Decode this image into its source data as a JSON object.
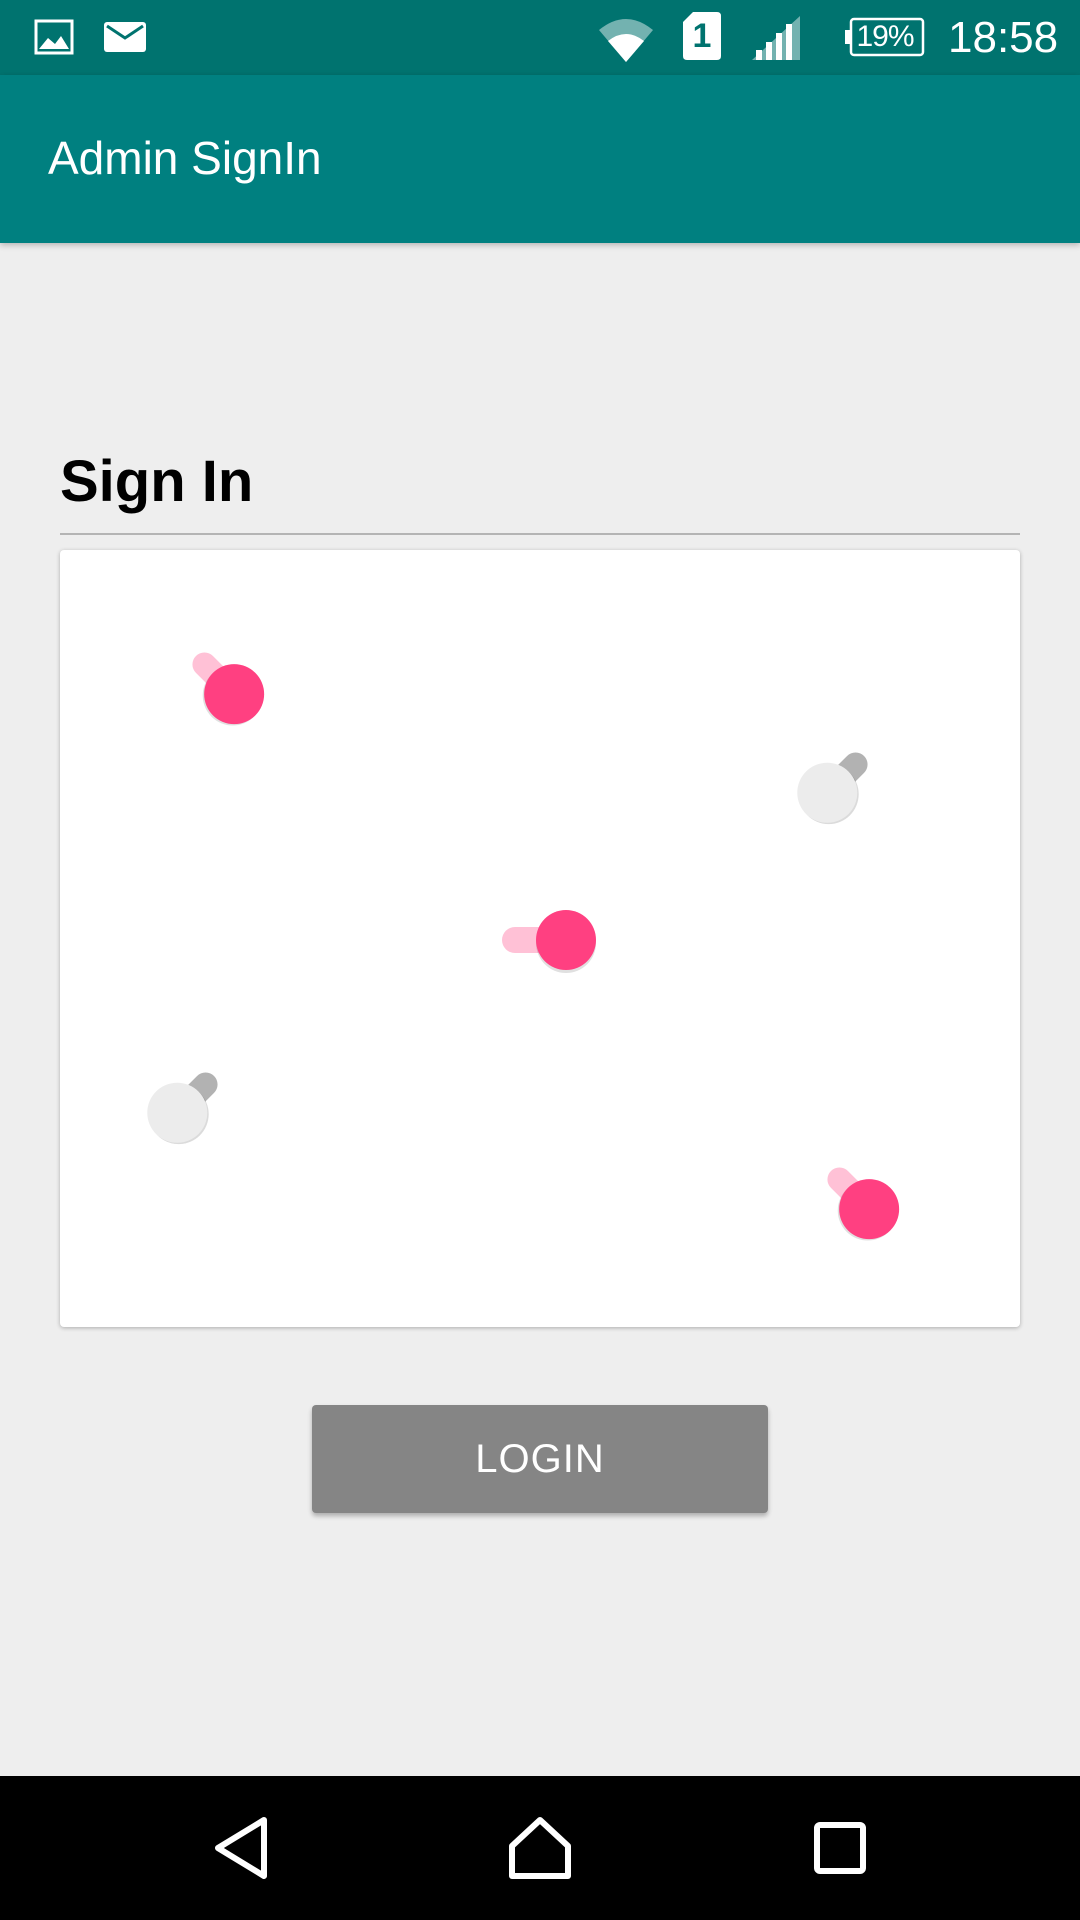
{
  "status_bar": {
    "notification_icons": [
      "image-icon",
      "mail-icon"
    ],
    "system_icons": [
      "wifi-icon",
      "sim-1-icon",
      "signal-icon",
      "battery-icon"
    ],
    "sim_label": "1",
    "battery_text": "19%",
    "time": "18:58",
    "background_color": "#00736f"
  },
  "app_bar": {
    "title": "Admin SignIn",
    "background_color": "#008080"
  },
  "form": {
    "section_title": "Sign In",
    "switches": [
      {
        "name": "switch-1",
        "state": "on"
      },
      {
        "name": "switch-2",
        "state": "off"
      },
      {
        "name": "switch-3",
        "state": "on"
      },
      {
        "name": "switch-4",
        "state": "off"
      },
      {
        "name": "switch-5",
        "state": "on"
      }
    ],
    "switch_on_color": "#ff4081",
    "switch_off_color": "#ececec"
  },
  "login_button": {
    "label": "LOGIN"
  },
  "nav_bar": {
    "buttons": [
      "back-icon",
      "home-icon",
      "recents-icon"
    ]
  }
}
